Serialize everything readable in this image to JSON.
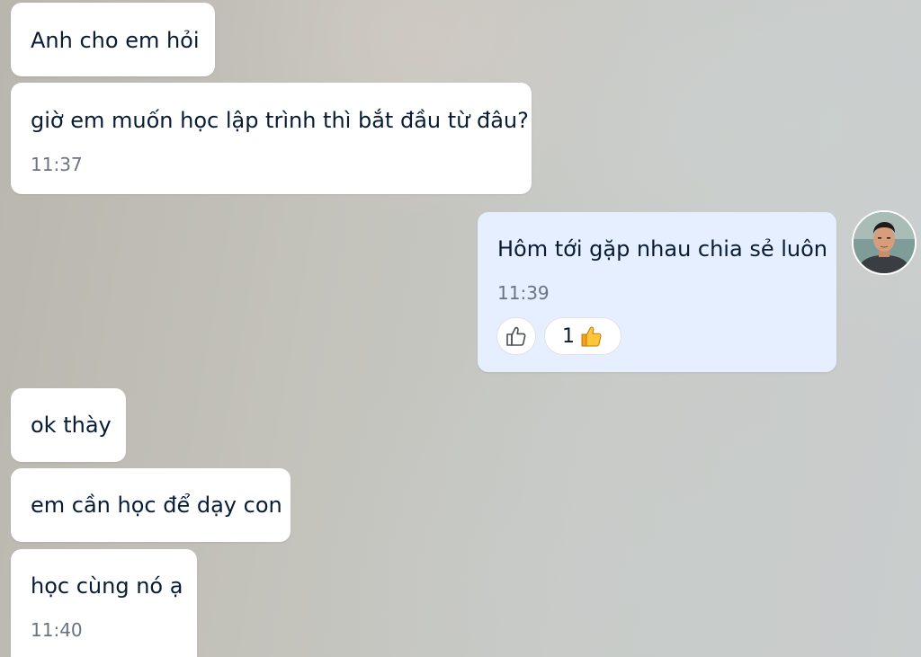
{
  "messages": [
    {
      "text": "Anh cho em hỏi",
      "time": ""
    },
    {
      "text": "giờ em muốn học lập trình thì bắt đầu từ đâu?",
      "time": "11:37"
    },
    {
      "text": "Hôm tới gặp nhau chia sẻ luôn",
      "time": "11:39"
    },
    {
      "text": "ok thày",
      "time": ""
    },
    {
      "text": "em cần học để dạy con",
      "time": ""
    },
    {
      "text": "học cùng nó ạ",
      "time": "11:40"
    }
  ],
  "reaction": {
    "count": "1",
    "emoji": "👍",
    "icon": "thumbs-up-icon"
  },
  "colors": {
    "incoming_bubble": "#ffffff",
    "outgoing_bubble": "#e5efff",
    "text": "#081c36",
    "time": "#6b7380"
  }
}
